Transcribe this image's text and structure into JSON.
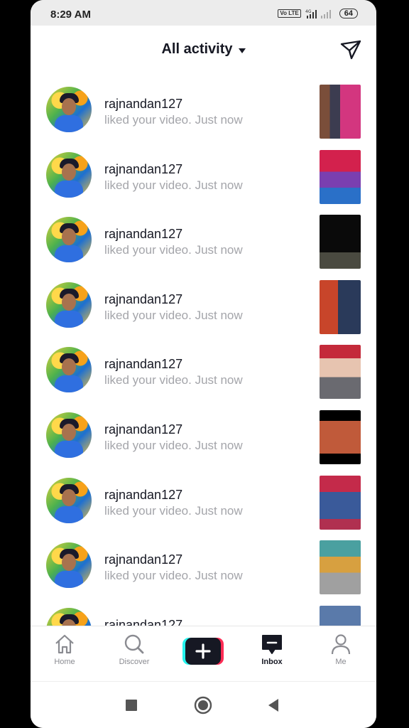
{
  "status_bar": {
    "time": "8:29 AM",
    "network": "4G",
    "volte": "Vo LTE",
    "battery": "64"
  },
  "header": {
    "title": "All activity",
    "filter_icon": "send-filter-icon"
  },
  "activity": [
    {
      "username": "rajnandan127",
      "message": "liked your video. Just now"
    },
    {
      "username": "rajnandan127",
      "message": "liked your video. Just now"
    },
    {
      "username": "rajnandan127",
      "message": "liked your video. Just now"
    },
    {
      "username": "rajnandan127",
      "message": "liked your video. Just now"
    },
    {
      "username": "rajnandan127",
      "message": "liked your video. Just now"
    },
    {
      "username": "rajnandan127",
      "message": "liked your video. Just now"
    },
    {
      "username": "rajnandan127",
      "message": "liked your video. Just now"
    },
    {
      "username": "rajnandan127",
      "message": "liked your video. Just now"
    },
    {
      "username": "rajnandan127",
      "message": ""
    }
  ],
  "bottom_nav": {
    "home": "Home",
    "discover": "Discover",
    "inbox": "Inbox",
    "me": "Me",
    "active": "Inbox"
  },
  "colors": {
    "accent_cyan": "#25f4ee",
    "accent_pink": "#fe2c55",
    "text_primary": "#161823",
    "text_secondary": "#a4a5aa"
  }
}
